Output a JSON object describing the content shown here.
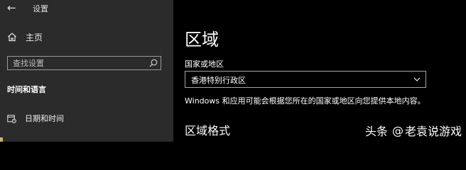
{
  "window": {
    "title": "设置",
    "back_icon": "back-arrow-icon"
  },
  "sidebar": {
    "home_label": "主页",
    "home_icon": "home-icon",
    "search_placeholder": "查找设置",
    "search_icon": "search-icon",
    "section_heading": "时间和语言",
    "items": [
      {
        "label": "日期和时间",
        "icon": "calendar-clock-icon"
      }
    ]
  },
  "main": {
    "page_title": "区域",
    "region_field": {
      "label": "国家或地区",
      "selected_value": "香港特别行政区",
      "chevron_icon": "chevron-down-icon"
    },
    "info_text": "Windows 和应用可能会根据您所在的国家或地区向您提供本地内容。",
    "section_title": "区域格式"
  },
  "watermark": {
    "brand": "头条",
    "at": "@",
    "author": "老袁说游戏"
  },
  "colors": {
    "sidebar_bg": "#2b2b2b",
    "main_bg": "#000000",
    "text": "#ffffff",
    "border": "#a5a5a5"
  }
}
